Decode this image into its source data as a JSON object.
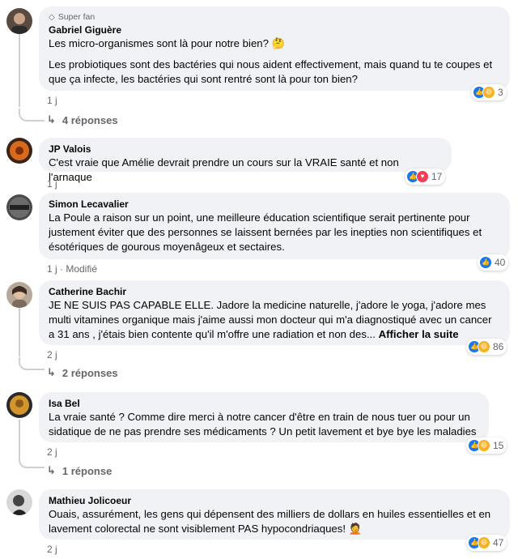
{
  "comments": [
    {
      "badge": "Super fan",
      "name": "Gabriel Giguère",
      "paragraphs": [
        "Les micro-organismes sont là pour notre bien? 🤔",
        "Les probiotiques sont des bactéries qui nous aident effectivement, mais quand tu te coupes et que ça infecte, les bactéries qui sont rentré sont là pour ton bien?"
      ],
      "time": "1 j",
      "reaction_count": "3",
      "replies": "4 réponses"
    },
    {
      "name": "JP Valois",
      "text": "C'est vraie que Amélie devrait prendre un cours sur la VRAIE santé et non l'arnaque",
      "time": "1 j",
      "reaction_count": "17"
    },
    {
      "name": "Simon Lecavalier",
      "text": "La Poule a raison sur un point, une meilleure éducation scientifique serait pertinente pour justement éviter que des personnes se laissent bernées par les inepties non scientifiques et ésotériques de gourous moyenâgeux et sectaires.",
      "time": "1 j · Modifié",
      "reaction_count": "40"
    },
    {
      "name": "Catherine Bachir",
      "text": "JE NE SUIS PAS CAPABLE ELLE. Jadore la medicine naturelle, j'adore le yoga, j'adore mes multi vitamines organique mais j'aime aussi mon docteur qui m'a diagnostiqué avec un cancer a 31 ans , j'étais bien contente qu'il m'offre une radiation et non des...",
      "see_more": "Afficher la suite",
      "time": "2 j",
      "reaction_count": "86",
      "replies": "2 réponses"
    },
    {
      "name": "Isa Bel",
      "text": "La vraie santé ? Comme dire merci à notre cancer d'être en train de nous tuer ou pour un sidatique de ne pas prendre ses médicaments ? Un petit lavement et bye bye les maladies",
      "time": "2 j",
      "reaction_count": "15",
      "replies": "1 réponse"
    },
    {
      "name": "Mathieu Jolicoeur",
      "text": "Ouais, assurément, les gens qui dépensent des milliers de dollars en huiles essentielles et en lavement colorectal ne sont visiblement PAS hypocondriaques! 🤦",
      "time": "2 j",
      "reaction_count": "47"
    }
  ],
  "colors": {
    "bubble": "#f0f2f5",
    "meta": "#65676b",
    "like": "#1877f2",
    "haha": "#f7b125",
    "love": "#f33e58"
  }
}
